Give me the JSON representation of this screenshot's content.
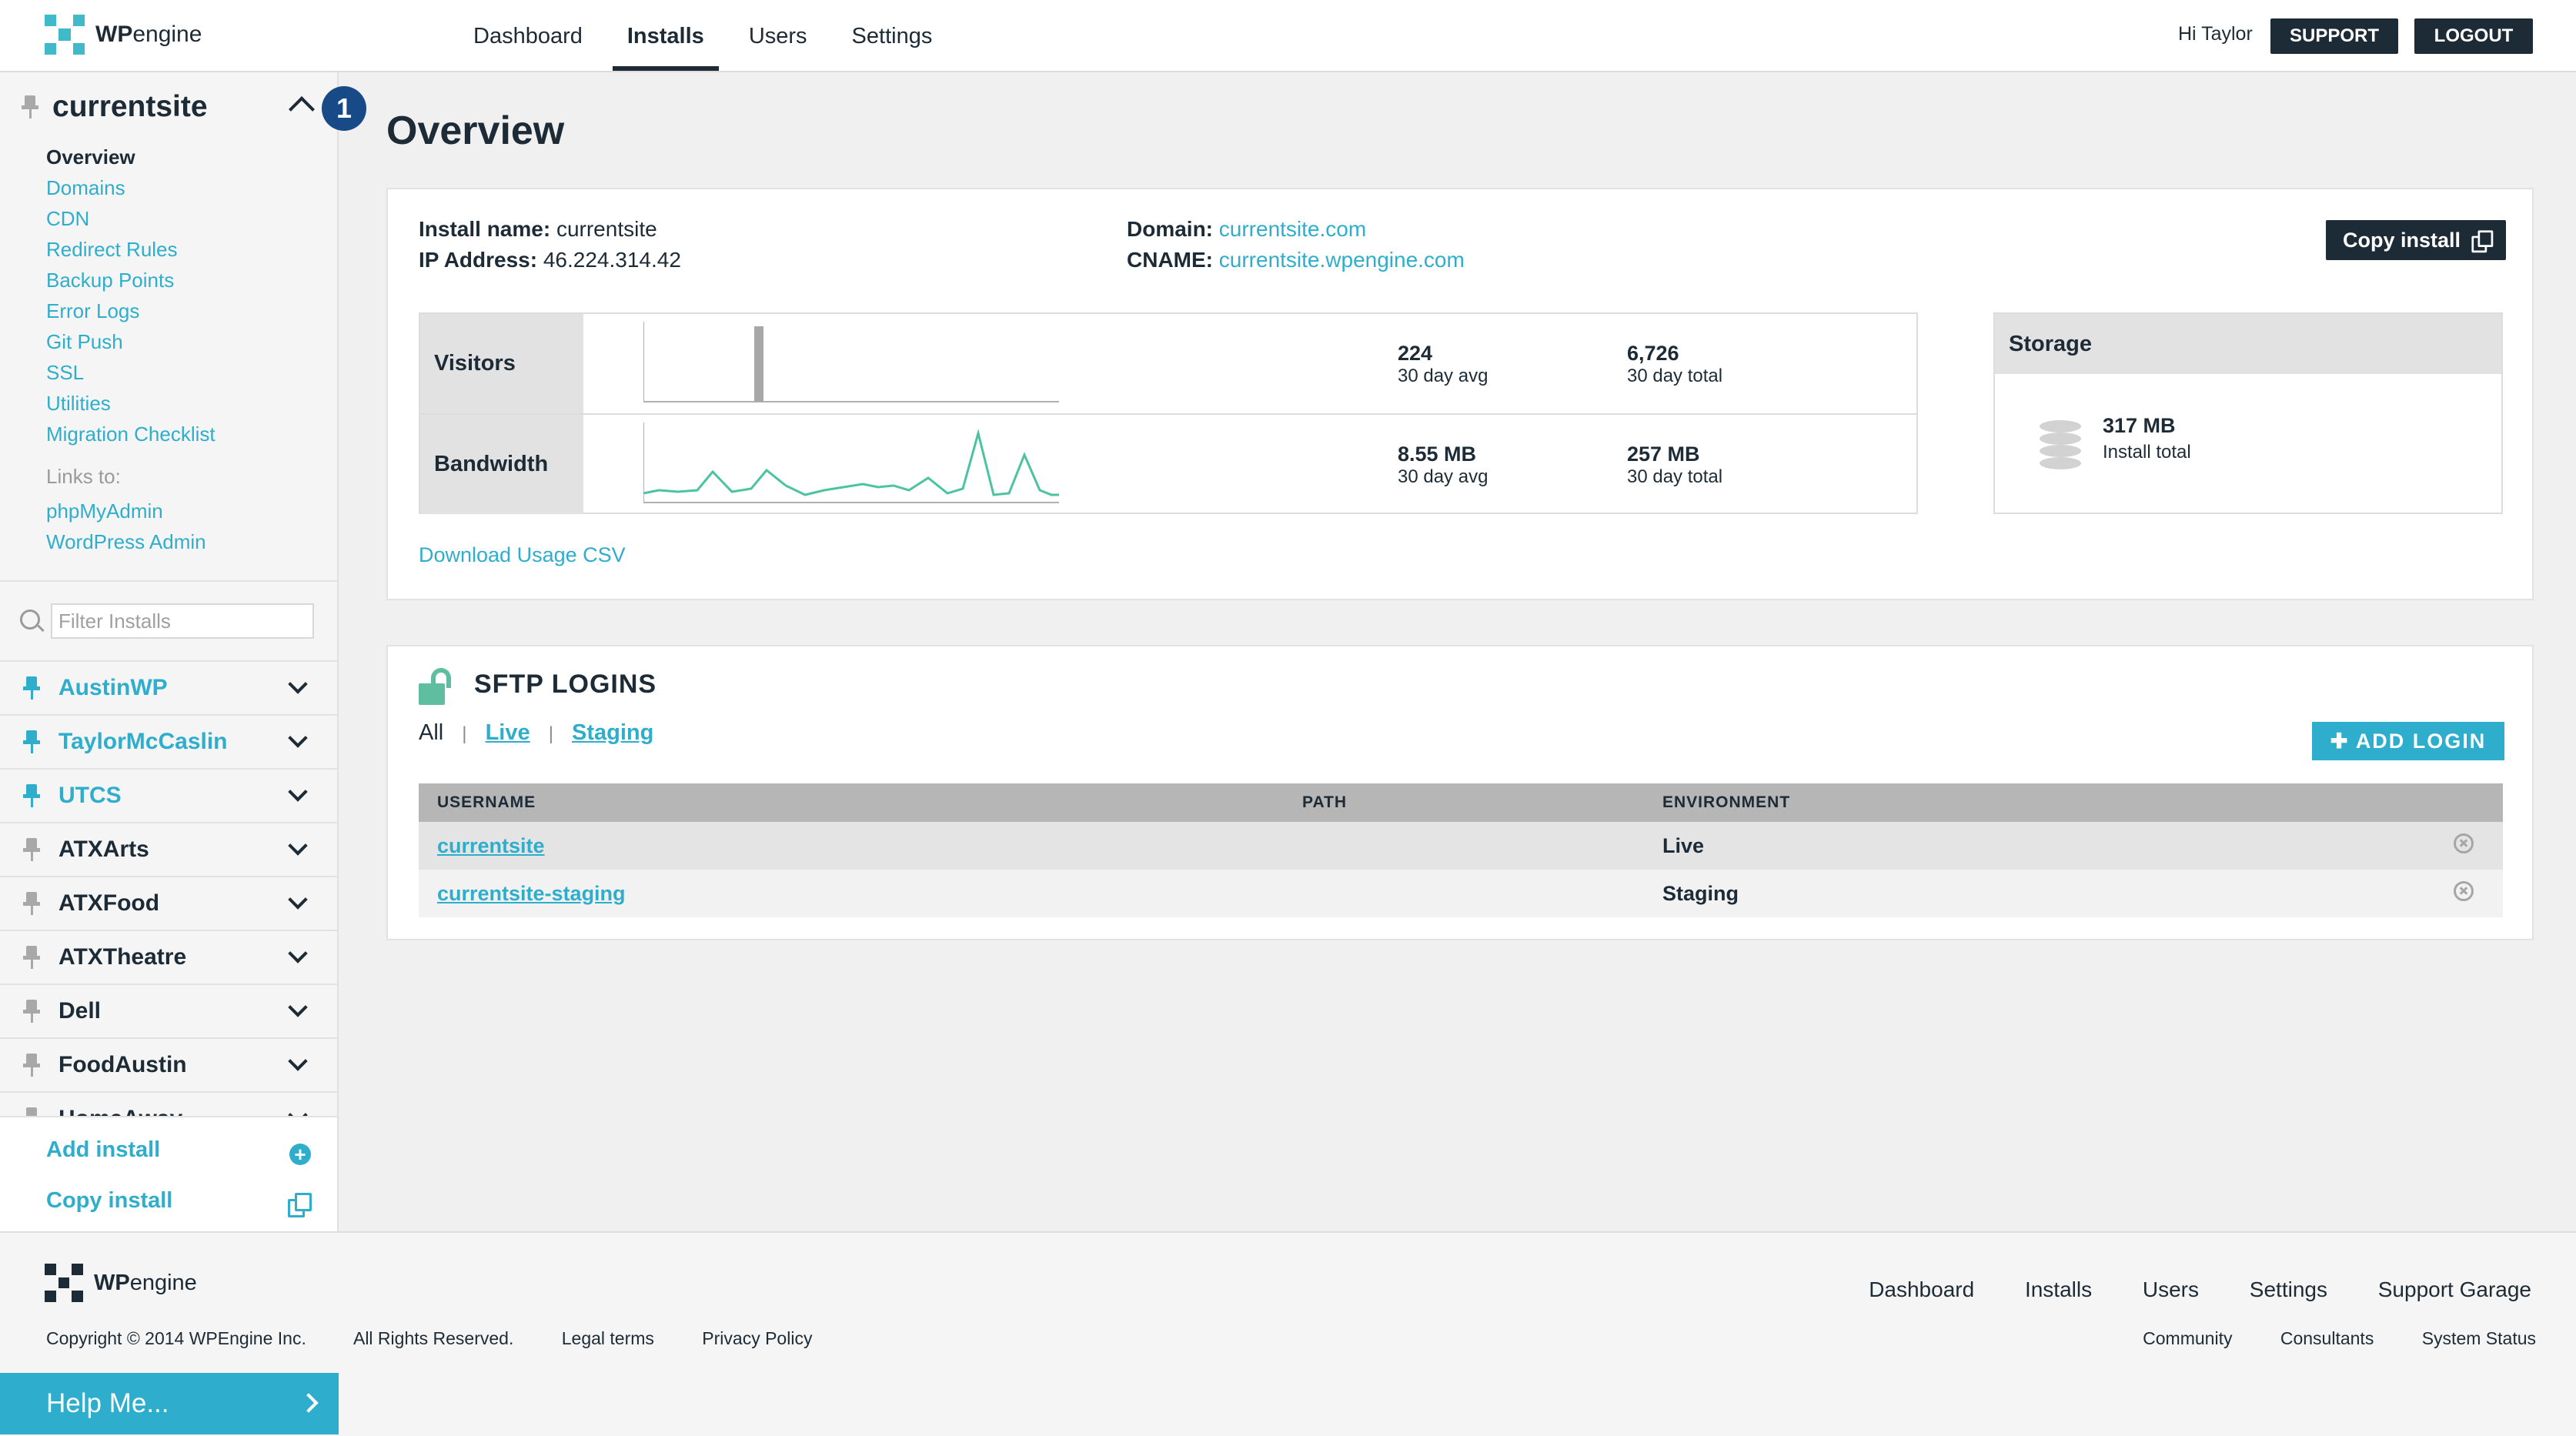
{
  "header": {
    "logo_bold": "WP",
    "logo_light": "engine",
    "nav": [
      "Dashboard",
      "Installs",
      "Users",
      "Settings"
    ],
    "active_nav": "Installs",
    "greeting": "Hi Taylor",
    "support": "SUPPORT",
    "logout": "LOGOUT"
  },
  "sidebar": {
    "current_install": "currentsite",
    "step_badge": "1",
    "sub_nav": [
      "Overview",
      "Domains",
      "CDN",
      "Redirect Rules",
      "Backup Points",
      "Error Logs",
      "Git Push",
      "SSL",
      "Utilities",
      "Migration Checklist"
    ],
    "links_to_label": "Links to:",
    "links": [
      "phpMyAdmin",
      "WordPress Admin"
    ],
    "filter_placeholder": "Filter Installs",
    "installs": [
      {
        "name": "AustinWP",
        "favorite": true
      },
      {
        "name": "TaylorMcCaslin",
        "favorite": true
      },
      {
        "name": "UTCS",
        "favorite": true
      },
      {
        "name": "ATXArts",
        "favorite": false
      },
      {
        "name": "ATXFood",
        "favorite": false
      },
      {
        "name": "ATXTheatre",
        "favorite": false
      },
      {
        "name": "Dell",
        "favorite": false
      },
      {
        "name": "FoodAustin",
        "favorite": false
      },
      {
        "name": "HomeAway",
        "favorite": false
      }
    ],
    "add_install": "Add install",
    "copy_install": "Copy install"
  },
  "main": {
    "title": "Overview",
    "install_name_label": "Install name:",
    "install_name": "currentsite",
    "ip_label": "IP Address:",
    "ip": "46.224.314.42",
    "domain_label": "Domain:",
    "domain": "currentsite.com",
    "cname_label": "CNAME:",
    "cname": "currentsite.wpengine.com",
    "copy_install_btn": "Copy install",
    "usage": {
      "visitors": {
        "label": "Visitors",
        "avg": "224",
        "avg_label": "30 day avg",
        "total": "6,726",
        "total_label": "30 day total"
      },
      "bandwidth": {
        "label": "Bandwidth",
        "avg": "8.55 MB",
        "avg_label": "30 day avg",
        "total": "257 MB",
        "total_label": "30 day total"
      }
    },
    "storage": {
      "title": "Storage",
      "value": "317 MB",
      "label": "Install total"
    },
    "csv_link": "Download Usage CSV",
    "sftp": {
      "title": "SFTP LOGINS",
      "filter_all": "All",
      "filter_live": "Live",
      "filter_staging": "Staging",
      "add_login": "ADD LOGIN",
      "columns": [
        "USERNAME",
        "PATH",
        "ENVIRONMENT"
      ],
      "rows": [
        {
          "username": "currentsite",
          "path": "",
          "environment": "Live"
        },
        {
          "username": "currentsite-staging",
          "path": "",
          "environment": "Staging"
        }
      ]
    }
  },
  "footer": {
    "copyright": "Copyright © 2014 WPEngine Inc.",
    "rights": "All Rights Reserved.",
    "legal": "Legal terms",
    "privacy": "Privacy Policy",
    "nav": [
      "Dashboard",
      "Installs",
      "Users",
      "Settings",
      "Support Garage"
    ],
    "sub_nav": [
      "Community",
      "Consultants",
      "System Status"
    ],
    "help": "Help Me..."
  },
  "colors": {
    "accent": "#2eaecc",
    "dark": "#1d2b36",
    "chart_line": "#4cc3a0",
    "badge": "#174a86"
  }
}
